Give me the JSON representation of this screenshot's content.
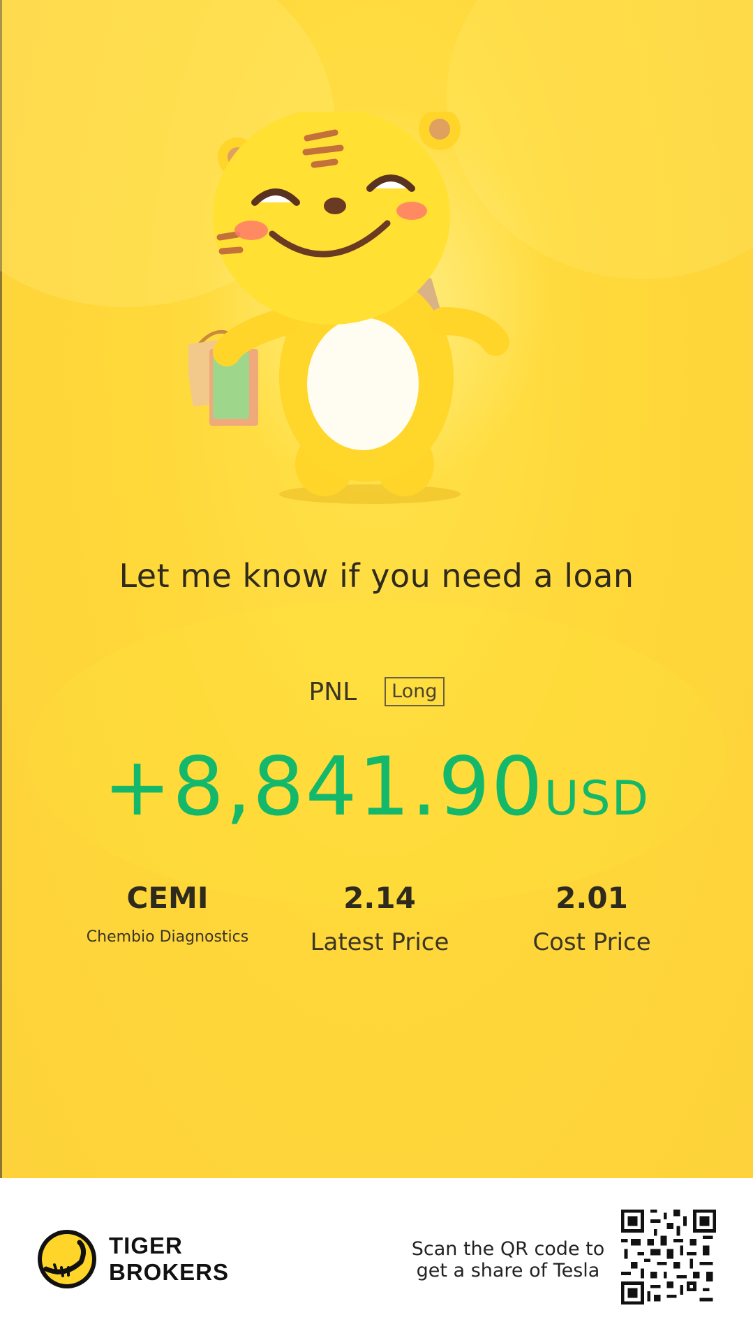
{
  "share_card": {
    "headline": "Let me know if you need a loan",
    "pnl": {
      "label": "PNL",
      "position_badge": "Long",
      "amount": "+8,841.90",
      "currency": "USD"
    },
    "stock": {
      "ticker": "CEMI",
      "name": "Chembio Diagnostics",
      "latest_price": "2.14",
      "latest_price_label": "Latest Price",
      "cost_price": "2.01",
      "cost_price_label": "Cost Price"
    }
  },
  "footer": {
    "brand_line1": "TIGER",
    "brand_line2": "BROKERS",
    "scan_line1": "Scan the QR code to",
    "scan_line2": "get a share of Tesla"
  },
  "colors": {
    "background": "#fdd83a",
    "pnl_positive": "#14b86a",
    "text_dark": "#2e2a1e"
  },
  "icons": {
    "mascot": "tiger-mascot-with-shopping-bags",
    "logo": "tiger-brokers-logo-icon",
    "qr": "qr-code-icon"
  }
}
